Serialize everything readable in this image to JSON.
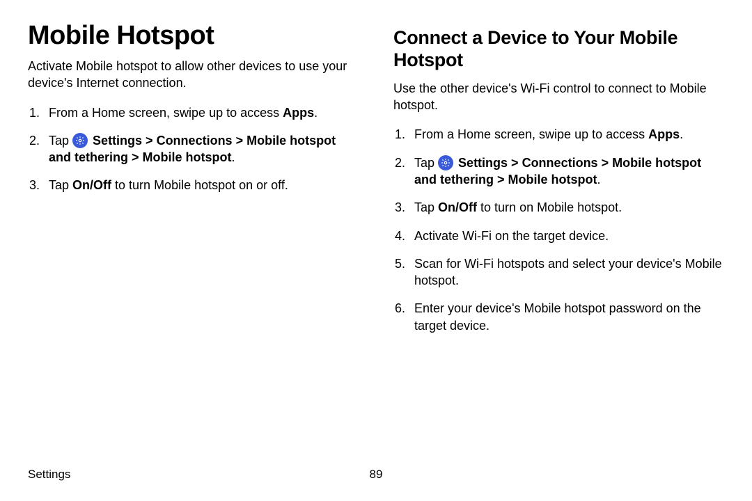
{
  "left": {
    "title": "Mobile Hotspot",
    "intro": "Activate Mobile hotspot to allow other devices to use your device's Internet connection.",
    "steps": {
      "s1_pre": "From a Home screen, swipe up to access ",
      "s1_bold": "Apps",
      "s1_post": ".",
      "s2_pre": "Tap ",
      "s2_bold": "Settings > Connections > Mobile hotspot and tethering > Mobile hotspot",
      "s2_post": ".",
      "s3_pre": "Tap ",
      "s3_bold": "On/Off",
      "s3_post": " to turn Mobile hotspot on or off."
    }
  },
  "right": {
    "title": "Connect a Device to Your Mobile Hotspot",
    "intro": "Use the other device's Wi-Fi control to connect to Mobile hotspot.",
    "steps": {
      "s1_pre": "From a Home screen, swipe up to access ",
      "s1_bold": "Apps",
      "s1_post": ".",
      "s2_pre": "Tap ",
      "s2_bold": "Settings > Connections > Mobile hotspot and tethering > Mobile hotspot",
      "s2_post": ".",
      "s3_pre": "Tap ",
      "s3_bold": "On/Off",
      "s3_post": " to turn on Mobile hotspot.",
      "s4": "Activate Wi-Fi on the target device.",
      "s5": "Scan for Wi-Fi hotspots and select your device's Mobile hotspot.",
      "s6": "Enter your device's Mobile hotspot password on the target device."
    }
  },
  "footer": {
    "section": "Settings",
    "page": "89"
  },
  "colors": {
    "settings_icon_bg": "#3a5bd9"
  }
}
